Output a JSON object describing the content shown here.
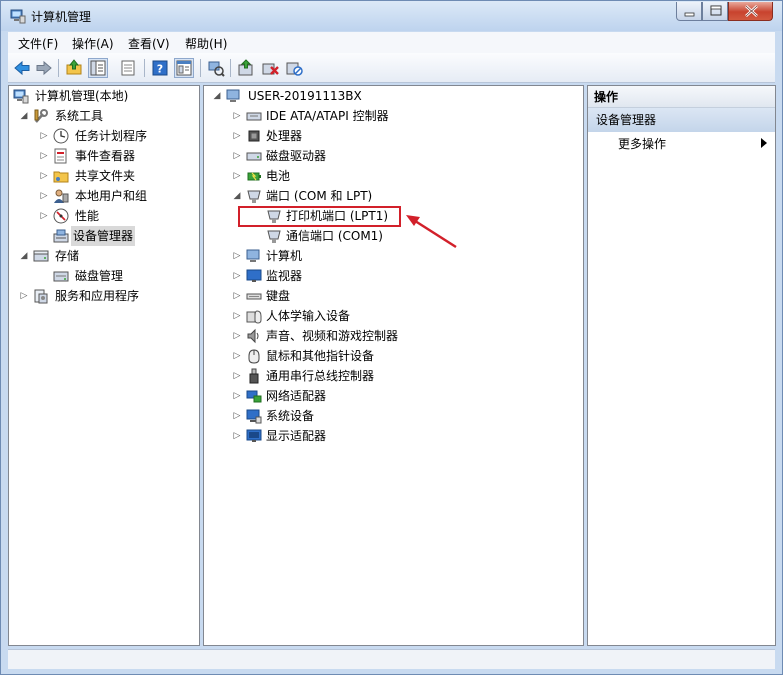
{
  "window": {
    "title": "计算机管理"
  },
  "menu": [
    {
      "label": "文件(F)"
    },
    {
      "label": "操作(A)"
    },
    {
      "label": "查看(V)"
    },
    {
      "label": "帮助(H)"
    }
  ],
  "left_tree": {
    "root": "计算机管理(本地)",
    "system_tools": "系统工具",
    "task_scheduler": "任务计划程序",
    "event_viewer": "事件查看器",
    "shared_folders": "共享文件夹",
    "local_users": "本地用户和组",
    "performance": "性能",
    "device_manager": "设备管理器",
    "storage": "存储",
    "disk_management": "磁盘管理",
    "services_apps": "服务和应用程序"
  },
  "device_tree": {
    "root": "USER-20191113BX",
    "items": [
      {
        "label": "IDE ATA/ATAPI 控制器"
      },
      {
        "label": "处理器"
      },
      {
        "label": "磁盘驱动器"
      },
      {
        "label": "电池"
      },
      {
        "label": "端口 (COM 和 LPT)"
      },
      {
        "label": "打印机端口 (LPT1)"
      },
      {
        "label": "通信端口 (COM1)"
      },
      {
        "label": "计算机"
      },
      {
        "label": "监视器"
      },
      {
        "label": "键盘"
      },
      {
        "label": "人体学输入设备"
      },
      {
        "label": "声音、视频和游戏控制器"
      },
      {
        "label": "鼠标和其他指针设备"
      },
      {
        "label": "通用串行总线控制器"
      },
      {
        "label": "网络适配器"
      },
      {
        "label": "系统设备"
      },
      {
        "label": "显示适配器"
      }
    ]
  },
  "actions_pane": {
    "header": "操作",
    "section": "设备管理器",
    "more_actions": "更多操作"
  },
  "colors": {
    "highlight": "#d2202a",
    "selection": "#d9d9d9",
    "accent": "#3b7cd4"
  },
  "icons": [
    "computer-management-icon",
    "back-icon",
    "forward-icon",
    "up-icon",
    "show-tree-icon",
    "properties-icon",
    "help-icon",
    "scan-hardware-icon",
    "update-driver-icon",
    "uninstall-icon",
    "disable-icon"
  ]
}
